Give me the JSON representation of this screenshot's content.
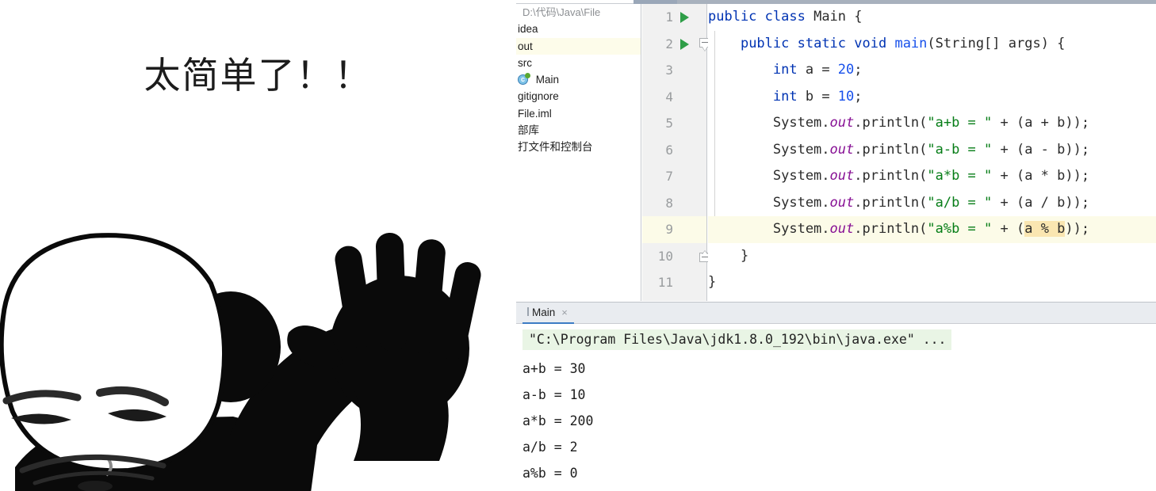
{
  "meme": {
    "caption": "太简单了！！",
    "alt": "panda-man-waving-meme"
  },
  "ide": {
    "project_tree": {
      "items": [
        {
          "label": "D:\\代码\\Java\\File",
          "type": "root",
          "selected": false,
          "icon": ""
        },
        {
          "label": "idea",
          "type": "folder",
          "selected": false,
          "icon": ""
        },
        {
          "label": "out",
          "type": "folder",
          "selected": true,
          "icon": ""
        },
        {
          "label": "src",
          "type": "folder",
          "selected": false,
          "icon": ""
        },
        {
          "label": "Main",
          "type": "java-class",
          "selected": false,
          "icon": "java-class-icon"
        },
        {
          "label": "gitignore",
          "type": "file",
          "selected": false,
          "icon": ""
        },
        {
          "label": "File.iml",
          "type": "file",
          "selected": false,
          "icon": ""
        },
        {
          "label": "external-libraries",
          "type": "node",
          "selected": false,
          "icon": ""
        },
        {
          "label": "scratches-and-consoles",
          "type": "node",
          "selected": false,
          "icon": ""
        }
      ],
      "truncated_labels": {
        "external_libraries": "部库",
        "scratches_consoles": "打文件和控制台"
      }
    },
    "editor": {
      "gutter": {
        "line_numbers": [
          "1",
          "2",
          "3",
          "4",
          "5",
          "6",
          "7",
          "8",
          "9",
          "10",
          "11"
        ],
        "run_arrow_lines": [
          1,
          2
        ],
        "fold_start_line": 2,
        "fold_end_line": 10,
        "active_line": 9
      },
      "lines": [
        {
          "n": 1,
          "tokens": [
            {
              "t": "public ",
              "c": "kw"
            },
            {
              "t": "class ",
              "c": "kw"
            },
            {
              "t": "Main",
              "c": "pln"
            },
            {
              "t": " {",
              "c": "pln"
            }
          ]
        },
        {
          "n": 2,
          "tokens": [
            {
              "t": "    ",
              "c": "pln"
            },
            {
              "t": "public ",
              "c": "kw"
            },
            {
              "t": "static ",
              "c": "kw"
            },
            {
              "t": "void ",
              "c": "kw"
            },
            {
              "t": "main",
              "c": "cls"
            },
            {
              "t": "(String[] args) {",
              "c": "pln"
            }
          ]
        },
        {
          "n": 3,
          "tokens": [
            {
              "t": "        ",
              "c": "pln"
            },
            {
              "t": "int ",
              "c": "kw"
            },
            {
              "t": "a = ",
              "c": "pln"
            },
            {
              "t": "20",
              "c": "num"
            },
            {
              "t": ";",
              "c": "pln"
            }
          ]
        },
        {
          "n": 4,
          "tokens": [
            {
              "t": "        ",
              "c": "pln"
            },
            {
              "t": "int ",
              "c": "kw"
            },
            {
              "t": "b = ",
              "c": "pln"
            },
            {
              "t": "10",
              "c": "num"
            },
            {
              "t": ";",
              "c": "pln"
            }
          ]
        },
        {
          "n": 5,
          "tokens": [
            {
              "t": "        System.",
              "c": "pln"
            },
            {
              "t": "out",
              "c": "fld"
            },
            {
              "t": ".println(",
              "c": "pln"
            },
            {
              "t": "\"a+b = \"",
              "c": "str"
            },
            {
              "t": " + (a + b));",
              "c": "pln"
            }
          ]
        },
        {
          "n": 6,
          "tokens": [
            {
              "t": "        System.",
              "c": "pln"
            },
            {
              "t": "out",
              "c": "fld"
            },
            {
              "t": ".println(",
              "c": "pln"
            },
            {
              "t": "\"a-b = \"",
              "c": "str"
            },
            {
              "t": " + (a - b));",
              "c": "pln"
            }
          ]
        },
        {
          "n": 7,
          "tokens": [
            {
              "t": "        System.",
              "c": "pln"
            },
            {
              "t": "out",
              "c": "fld"
            },
            {
              "t": ".println(",
              "c": "pln"
            },
            {
              "t": "\"a*b = \"",
              "c": "str"
            },
            {
              "t": " + (a * b));",
              "c": "pln"
            }
          ]
        },
        {
          "n": 8,
          "tokens": [
            {
              "t": "        System.",
              "c": "pln"
            },
            {
              "t": "out",
              "c": "fld"
            },
            {
              "t": ".println(",
              "c": "pln"
            },
            {
              "t": "\"a/b = \"",
              "c": "str"
            },
            {
              "t": " + (a / b));",
              "c": "pln"
            }
          ]
        },
        {
          "n": 9,
          "tokens": [
            {
              "t": "        System.",
              "c": "pln"
            },
            {
              "t": "out",
              "c": "fld"
            },
            {
              "t": ".println(",
              "c": "pln"
            },
            {
              "t": "\"a%b = \"",
              "c": "str"
            },
            {
              "t": " + (",
              "c": "pln"
            },
            {
              "t": "a % b",
              "c": "pln sel"
            },
            {
              "t": "));",
              "c": "pln"
            }
          ]
        },
        {
          "n": 10,
          "tokens": [
            {
              "t": "    }",
              "c": "pln"
            }
          ]
        },
        {
          "n": 11,
          "tokens": [
            {
              "t": "}",
              "c": "pln"
            }
          ]
        }
      ]
    },
    "console": {
      "tab_label": "Main",
      "close_label": "×",
      "command_line": "\"C:\\Program Files\\Java\\jdk1.8.0_192\\bin\\java.exe\" ...",
      "output_lines": [
        "a+b = 30",
        "a-b = 10",
        "a*b = 200",
        "a/b = 2",
        "a%b = 0"
      ]
    }
  },
  "colors": {
    "keyword": "#0033b3",
    "string": "#067d17",
    "field": "#871094",
    "number": "#1750eb",
    "selection": "#fae6b1",
    "caret_line": "#fcfbe8",
    "tree_selected": "#fdfcea",
    "console_cmd_bg": "#e9f5e5",
    "tab_underline": "#3c7cc4",
    "run_arrow": "#2e9e47"
  }
}
